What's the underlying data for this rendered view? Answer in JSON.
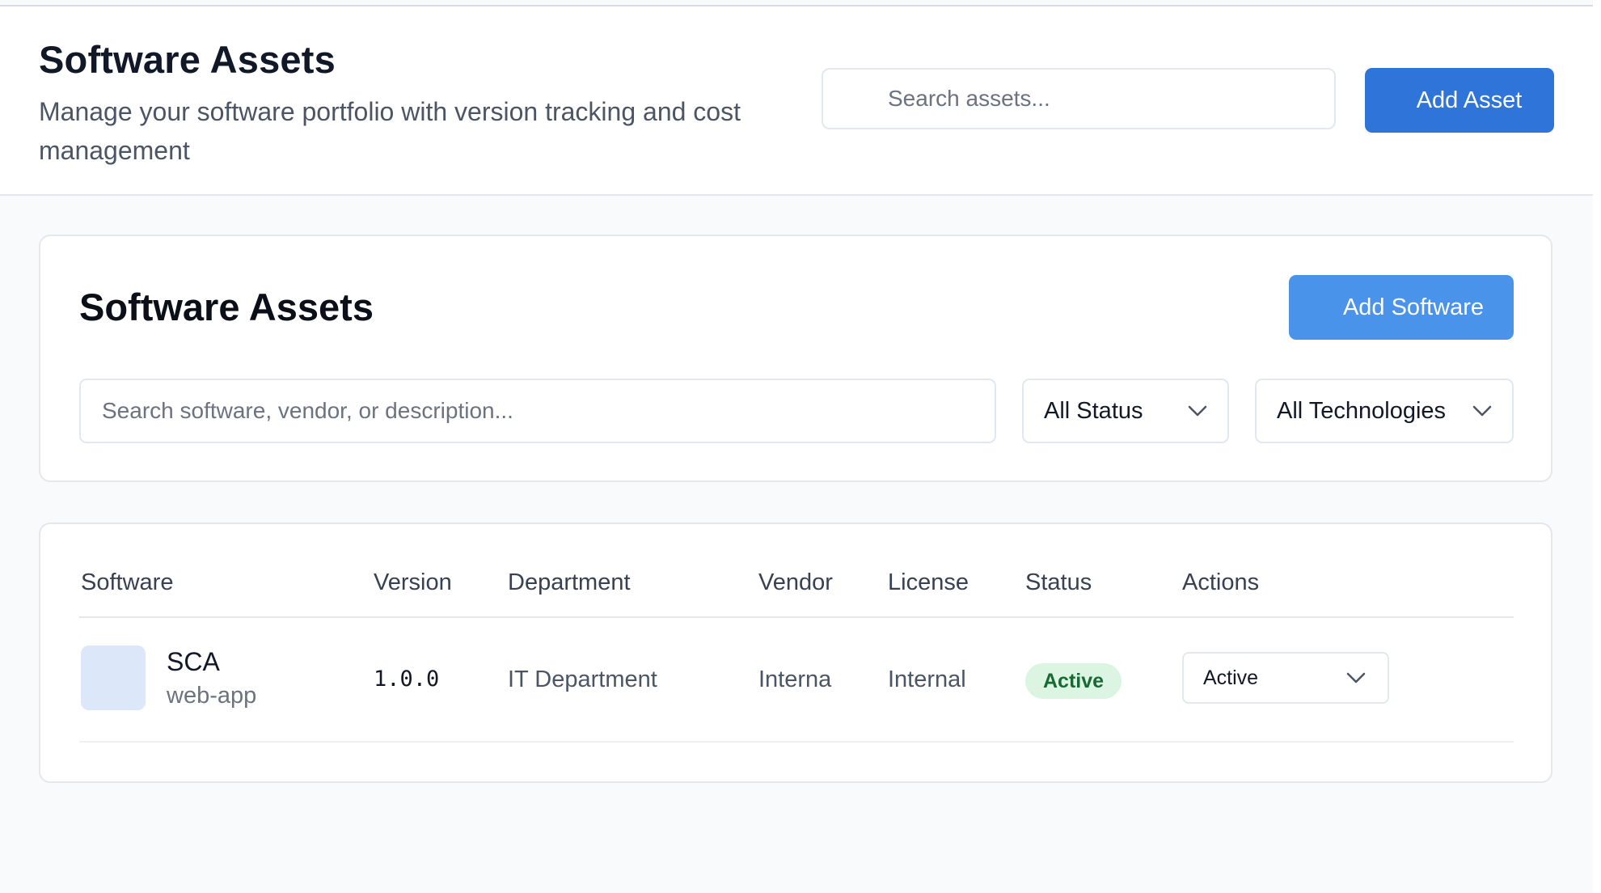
{
  "header": {
    "title": "Software Assets",
    "subtitle": "Manage your software portfolio with version tracking and cost management",
    "search_placeholder": "Search assets...",
    "add_button": "Add Asset"
  },
  "filters": {
    "title": "Software Assets",
    "add_button": "Add Software",
    "search_placeholder": "Search software, vendor, or description...",
    "status_select": "All Status",
    "technology_select": "All Technologies"
  },
  "table": {
    "columns": [
      "Software",
      "Version",
      "Department",
      "Vendor",
      "License",
      "Status",
      "Actions"
    ],
    "rows": [
      {
        "name": "SCA",
        "type": "web-app",
        "version": "1.0.0",
        "department": "IT Department",
        "vendor": "Interna",
        "license": "Internal",
        "status": "Active",
        "action": "Active"
      }
    ]
  },
  "colors": {
    "primary_button": "#2f74d8",
    "secondary_button": "#4a93ea",
    "status_active_bg": "#dcf5e3",
    "status_active_text": "#186a35"
  },
  "icons": {
    "dropdown": "chevron-down-icon"
  }
}
